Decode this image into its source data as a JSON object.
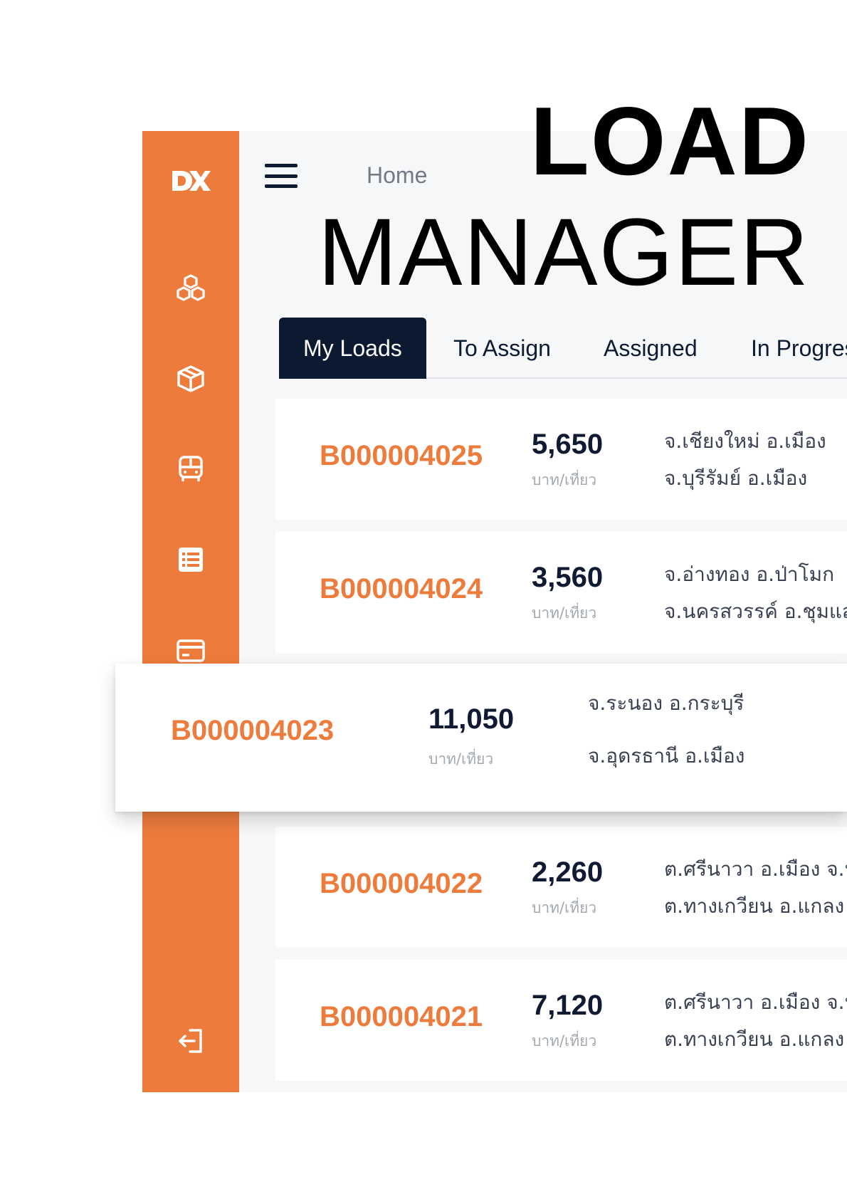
{
  "headline": {
    "line1": "LOAD",
    "line2": "MANAGER"
  },
  "header": {
    "breadcrumb": "Home"
  },
  "sidebar": {
    "logo_text": "DX",
    "icons": [
      "boxes-icon",
      "package-icon",
      "bus-icon",
      "list-icon",
      "credit-card-icon",
      "logout-icon"
    ],
    "accent_color": "#ED7B3C"
  },
  "tabs": [
    {
      "label": "My Loads",
      "active": true
    },
    {
      "label": "To Assign",
      "active": false
    },
    {
      "label": "Assigned",
      "active": false
    },
    {
      "label": "In Progres",
      "active": false
    }
  ],
  "loads": [
    {
      "id": "B000004025",
      "price": "5,650",
      "unit": "บาท/เที่ยว",
      "origin": "จ.เชียงใหม่ อ.เมือง",
      "destination": "จ.บุรีรัมย์ อ.เมือง"
    },
    {
      "id": "B000004024",
      "price": "3,560",
      "unit": "บาท/เที่ยว",
      "origin": "จ.อ่างทอง อ.ป่าโมก",
      "destination": "จ.นครสวรรค์ อ.ชุมแส"
    },
    {
      "id": "B000004023",
      "price": "11,050",
      "unit": "บาท/เที่ยว",
      "origin": "จ.ระนอง อ.กระบุรี",
      "destination": "จ.อุดรธานี อ.เมือง"
    },
    {
      "id": "B000004022",
      "price": "2,260",
      "unit": "บาท/เที่ยว",
      "origin": "ต.ศรีนาวา อ.เมือง จ.น",
      "destination": "ต.ทางเกวียน อ.แกลง"
    },
    {
      "id": "B000004021",
      "price": "7,120",
      "unit": "บาท/เที่ยว",
      "origin": "ต.ศรีนาวา อ.เมือง จ.น",
      "destination": "ต.ทางเกวียน อ.แกลง"
    }
  ],
  "colors": {
    "navy": "#0B1A30",
    "orange": "#ED7B3C",
    "background": "#F6F7F9"
  }
}
